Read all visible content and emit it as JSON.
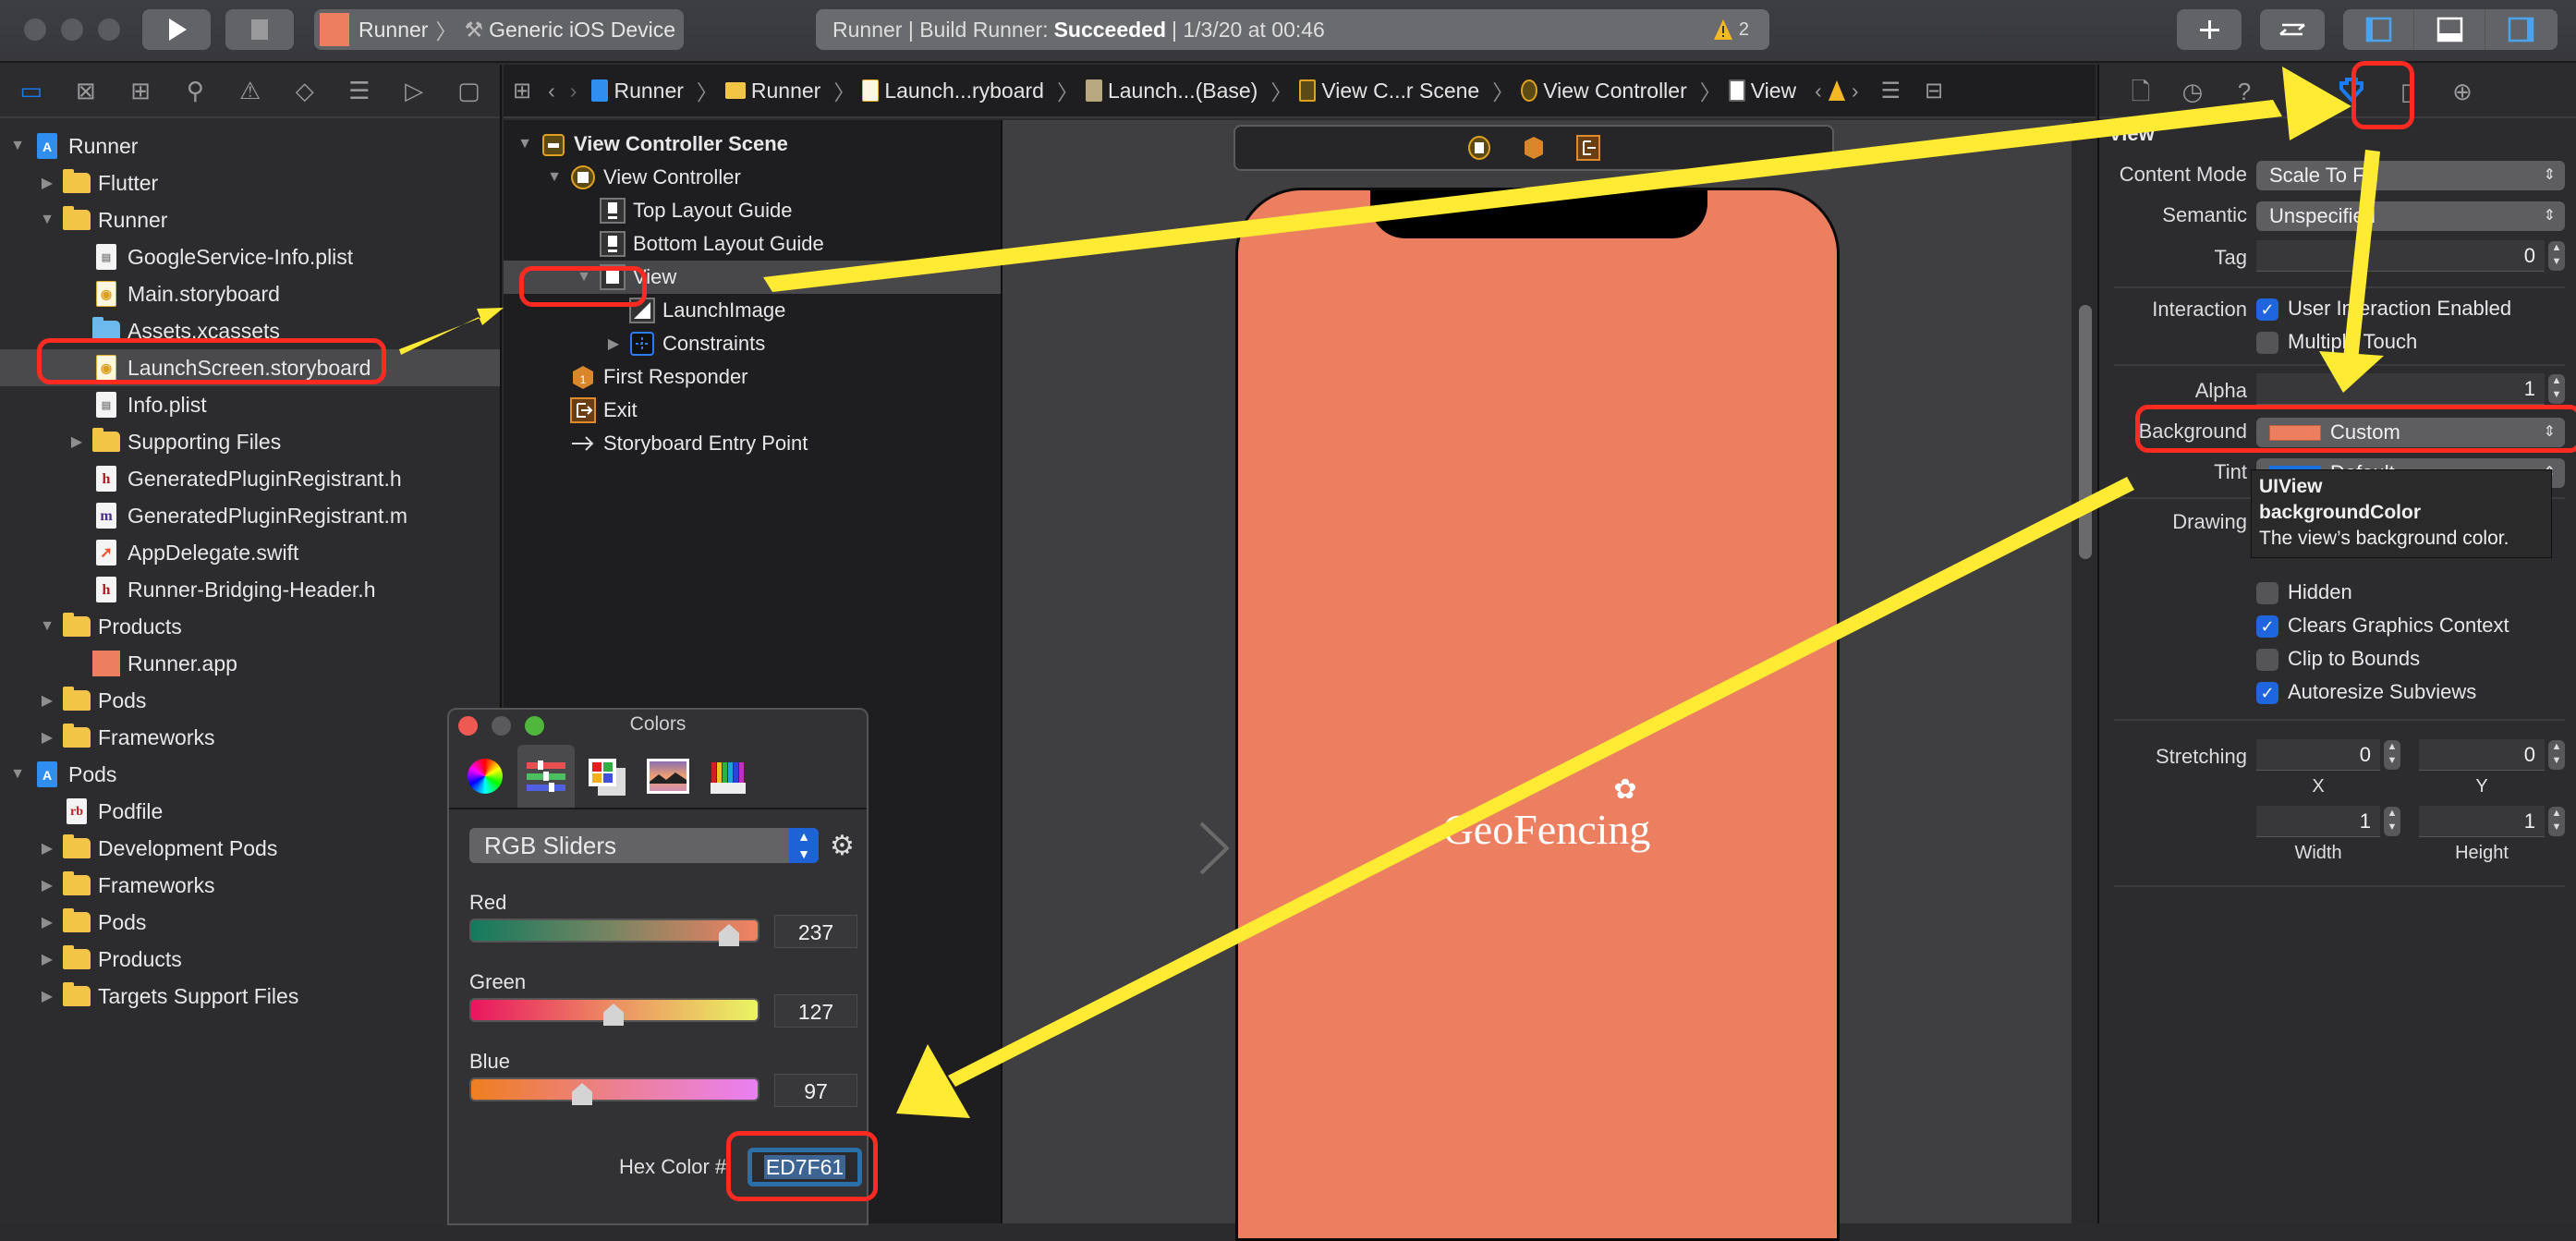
{
  "toolbar": {
    "scheme": "Runner",
    "destination": "Generic iOS Device",
    "status_prefix": "Runner | Build Runner:",
    "status_result": "Succeeded",
    "status_time": "| 1/3/20 at 00:46",
    "warning_count": "2",
    "icons": [
      "run-icon",
      "stop-icon",
      "add-library-icon",
      "code-review-icon",
      "toggle-navigator-icon",
      "toggle-debug-icon",
      "toggle-inspector-icon"
    ]
  },
  "navigator": {
    "tabs": [
      "project-navigator-icon",
      "source-control-icon",
      "symbol-navigator-icon",
      "find-icon",
      "issue-icon",
      "test-icon",
      "debug-icon",
      "breakpoint-icon",
      "report-icon"
    ],
    "items": [
      {
        "label": "Runner",
        "type": "project",
        "depth": 0,
        "expanded": true
      },
      {
        "label": "Flutter",
        "type": "folder",
        "depth": 1,
        "expanded": false
      },
      {
        "label": "Runner",
        "type": "folder",
        "depth": 1,
        "expanded": true
      },
      {
        "label": "GoogleService-Info.plist",
        "type": "plist",
        "depth": 2
      },
      {
        "label": "Main.storyboard",
        "type": "storyboard",
        "depth": 2
      },
      {
        "label": "Assets.xcassets",
        "type": "assets",
        "depth": 2
      },
      {
        "label": "LaunchScreen.storyboard",
        "type": "storyboard",
        "depth": 2,
        "selected": true
      },
      {
        "label": "Info.plist",
        "type": "plist",
        "depth": 2
      },
      {
        "label": "Supporting Files",
        "type": "folder",
        "depth": 2,
        "expanded": false
      },
      {
        "label": "GeneratedPluginRegistrant.h",
        "type": "h",
        "depth": 2
      },
      {
        "label": "GeneratedPluginRegistrant.m",
        "type": "m",
        "depth": 2
      },
      {
        "label": "AppDelegate.swift",
        "type": "swift",
        "depth": 2
      },
      {
        "label": "Runner-Bridging-Header.h",
        "type": "h",
        "depth": 2
      },
      {
        "label": "Products",
        "type": "folder",
        "depth": 1,
        "expanded": true
      },
      {
        "label": "Runner.app",
        "type": "app",
        "depth": 2
      },
      {
        "label": "Pods",
        "type": "folder",
        "depth": 1,
        "expanded": false
      },
      {
        "label": "Frameworks",
        "type": "folder",
        "depth": 1,
        "expanded": false
      },
      {
        "label": "Pods",
        "type": "project",
        "depth": 0,
        "expanded": true
      },
      {
        "label": "Podfile",
        "type": "rb",
        "depth": 1
      },
      {
        "label": "Development Pods",
        "type": "folder",
        "depth": 1,
        "expanded": false
      },
      {
        "label": "Frameworks",
        "type": "folder",
        "depth": 1,
        "expanded": false
      },
      {
        "label": "Pods",
        "type": "folder",
        "depth": 1,
        "expanded": false
      },
      {
        "label": "Products",
        "type": "folder",
        "depth": 1,
        "expanded": false
      },
      {
        "label": "Targets Support Files",
        "type": "folder",
        "depth": 1,
        "expanded": false
      }
    ]
  },
  "jumpbar": {
    "crumbs": [
      "Runner",
      "Runner",
      "Launch...ryboard",
      "Launch...(Base)",
      "View C...r Scene",
      "View Controller",
      "View"
    ]
  },
  "outline": {
    "items": [
      {
        "label": "View Controller Scene",
        "depth": 0,
        "bold": true,
        "icon": "scene-icon",
        "disc": "down"
      },
      {
        "label": "View Controller",
        "depth": 1,
        "icon": "view-controller-icon",
        "disc": "down"
      },
      {
        "label": "Top Layout Guide",
        "depth": 2,
        "icon": "layout-guide-icon"
      },
      {
        "label": "Bottom Layout Guide",
        "depth": 2,
        "icon": "layout-guide-icon"
      },
      {
        "label": "View",
        "depth": 2,
        "icon": "view-icon",
        "disc": "down",
        "selected": true
      },
      {
        "label": "LaunchImage",
        "depth": 3,
        "icon": "image-view-icon"
      },
      {
        "label": "Constraints",
        "depth": 3,
        "icon": "constraints-icon",
        "disc": "right"
      },
      {
        "label": "First Responder",
        "depth": 1,
        "icon": "first-responder-icon"
      },
      {
        "label": "Exit",
        "depth": 1,
        "icon": "exit-icon"
      },
      {
        "label": "Storyboard Entry Point",
        "depth": 1,
        "icon": "entry-point-icon"
      }
    ]
  },
  "canvas": {
    "logo_text": "GeoFencing",
    "background_color": "#ED7F61"
  },
  "inspector": {
    "tabs": [
      "file-inspector-icon",
      "history-inspector-icon",
      "quick-help-icon",
      "identity-inspector-icon",
      "attributes-inspector-icon",
      "size-inspector-icon",
      "connections-inspector-icon"
    ],
    "section_title": "View",
    "content_mode_label": "Content Mode",
    "content_mode_value": "Scale To Fill",
    "semantic_label": "Semantic",
    "semantic_value": "Unspecified",
    "tag_label": "Tag",
    "tag_value": "0",
    "interaction_label": "Interaction",
    "user_interaction": {
      "label": "User Interaction Enabled",
      "checked": true
    },
    "multiple_touch": {
      "label": "Multiple Touch",
      "checked": false
    },
    "alpha_label": "Alpha",
    "alpha_value": "1",
    "background_label": "Background",
    "background_value": "Custom",
    "background_swatch": "#ED7F61",
    "tint_label": "Tint",
    "tint_value": "Default",
    "tint_swatch": "#1a6fe0",
    "drawing_label": "Drawing",
    "drawing_hidden": {
      "label": "Hidden",
      "checked": false
    },
    "clears_graphics": {
      "label": "Clears Graphics Context",
      "checked": true
    },
    "clip_bounds": {
      "label": "Clip to Bounds",
      "checked": false
    },
    "autoresize": {
      "label": "Autoresize Subviews",
      "checked": true
    },
    "stretching_label": "Stretching",
    "stretch_x": "0",
    "stretch_y": "0",
    "stretch_w": "1",
    "stretch_h": "1",
    "x_label": "X",
    "y_label": "Y",
    "width_label": "Width",
    "height_label": "Height",
    "tooltip": {
      "class": "UIView",
      "property": "backgroundColor",
      "desc": "The view’s background color."
    }
  },
  "colors_panel": {
    "title": "Colors",
    "tabs": [
      "color-wheel-icon",
      "color-sliders-icon",
      "color-palettes-icon",
      "image-palettes-icon",
      "pencils-icon"
    ],
    "mode": "RGB Sliders",
    "red_label": "Red",
    "red_value": "237",
    "red_fraction": 0.929,
    "green_label": "Green",
    "green_value": "127",
    "green_fraction": 0.498,
    "blue_label": "Blue",
    "blue_value": "97",
    "blue_fraction": 0.38,
    "hex_label": "Hex Color #",
    "hex_value": "ED7F61"
  }
}
